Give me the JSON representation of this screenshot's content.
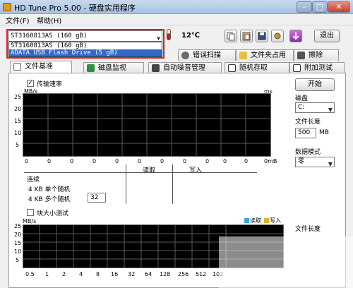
{
  "window": {
    "title": "HD Tune Pro 5.00 - 硬盘实用程序",
    "minimize": "–",
    "maximize": "□",
    "close": "✕"
  },
  "menu": {
    "file": "文件(F)",
    "help": "帮助(H)"
  },
  "toolbar": {
    "drive_selected": "ST3160813AS (160 gB)",
    "drive_options": [
      "ST3160813AS (160 gB)",
      "ADATA   USB Flash Drive  (5 gB)"
    ],
    "temperature": "12℃",
    "exit_label": "退出",
    "icons": [
      "copy-icon",
      "paste-icon",
      "save-icon",
      "settings-icon",
      "download-icon"
    ]
  },
  "tabs_top": [
    {
      "label": "错误扫描",
      "icon": "magnifier-icon"
    },
    {
      "label": "文件夹占用",
      "icon": "folder-icon"
    },
    {
      "label": "擦除",
      "icon": "trash-icon"
    }
  ],
  "tabs_bottom": [
    {
      "label": "文件基准",
      "icon": "document-icon"
    },
    {
      "label": "磁盘监视",
      "icon": "monitor-icon"
    },
    {
      "label": "自动噪音管理",
      "icon": "speaker-icon"
    },
    {
      "label": "随机存取",
      "icon": "random-icon"
    },
    {
      "label": "附加测试",
      "icon": "extra-icon"
    }
  ],
  "benchmark": {
    "transfer_rate_label": "传输速率",
    "unit_left": "MB/s",
    "unit_right": "ms",
    "y_ticks": [
      "25",
      "20",
      "15",
      "10",
      "5"
    ],
    "x_ticks": [
      "0",
      "0",
      "0",
      "0",
      "0",
      "0",
      "0",
      "0",
      "0",
      "0",
      "0",
      "0mB"
    ],
    "read_header": "读取",
    "write_header": "写入",
    "sequential": "连续",
    "random_4kb": "4 KB 单个随机",
    "random_4kb_multi": "4 KB 多个随机",
    "queue_depth": "32"
  },
  "block": {
    "label": "块大小测试",
    "unit": "MB/s",
    "legend_read": "读取",
    "legend_write": "写入",
    "y_ticks": [
      "25",
      "20",
      "15",
      "10",
      "5"
    ],
    "x_ticks": [
      "0.5",
      "1",
      "2",
      "4",
      "8",
      "16",
      "32",
      "64",
      "128",
      "256",
      "512",
      "102"
    ]
  },
  "side": {
    "start": "开始",
    "disk_label": "磁盘",
    "disk_value": "C:",
    "file_length_label": "文件长度",
    "file_length_value": "500",
    "file_length_unit": "MB",
    "data_mode_label": "数据模式",
    "data_mode_value": "零",
    "file_length_label2": "文件长度"
  },
  "colors": {
    "accent_red": "#e02020",
    "graph_bg": "#000000",
    "grid": "#5a5a5a",
    "read": "#3aa6d8",
    "write": "#e0b030"
  }
}
